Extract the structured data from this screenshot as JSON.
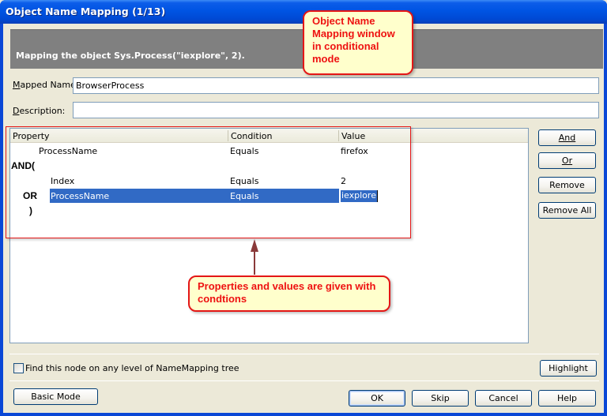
{
  "window": {
    "title": "Object Name Mapping (1/13)"
  },
  "header": {
    "message": "Mapping the object Sys.Process(\"iexplore\", 2)."
  },
  "form": {
    "mapped_name_label": "Mapped Name:",
    "mapped_name_value": "BrowserProcess",
    "description_label": "Description:",
    "description_value": ""
  },
  "grid": {
    "columns": [
      "Property",
      "Condition",
      "Value"
    ],
    "rows": [
      {
        "operator": "",
        "property": "ProcessName",
        "condition": "Equals",
        "value": "firefox",
        "selected": false
      },
      {
        "operator": "AND(",
        "property": "",
        "condition": "",
        "value": "",
        "selected": false
      },
      {
        "operator": "",
        "property": "Index",
        "condition": "Equals",
        "value": "2",
        "selected": false
      },
      {
        "operator": "OR",
        "property": "ProcessName",
        "condition": "Equals",
        "value": "iexplore",
        "selected": true
      },
      {
        "operator": ")",
        "property": "",
        "condition": "",
        "value": "",
        "selected": false
      }
    ]
  },
  "side_buttons": {
    "and": "And",
    "or": "Or",
    "remove": "Remove",
    "remove_all": "Remove All"
  },
  "options": {
    "find_any_level_label": "Find this node on any level of NameMapping tree",
    "find_any_level_checked": false,
    "highlight": "Highlight"
  },
  "footer": {
    "basic_mode": "Basic Mode",
    "ok": "OK",
    "skip": "Skip",
    "cancel": "Cancel",
    "help": "Help"
  },
  "annotations": {
    "callout_top": "Object Name Mapping window in conditional mode",
    "callout_bottom": "Properties and values are given with condtions",
    "callout_color": "#e41616",
    "callout_bg": "#ffffcc"
  }
}
